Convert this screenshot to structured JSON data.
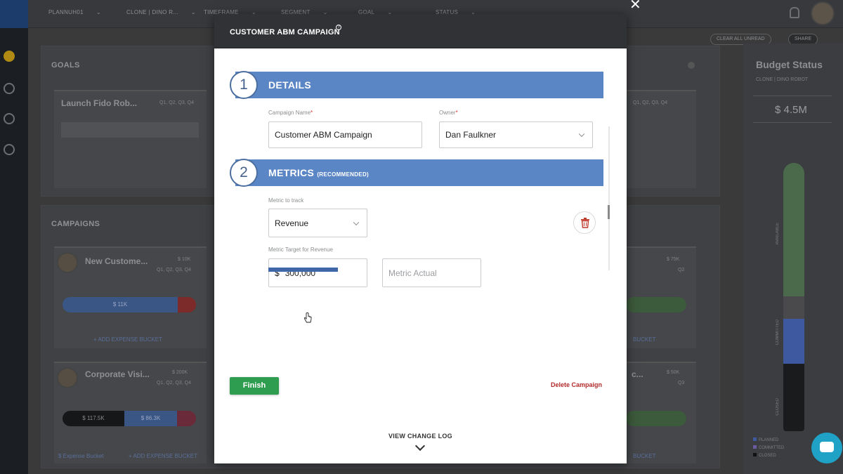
{
  "background": {
    "filters": [
      "PLANNUH01",
      "CLONE | DINO R...",
      "TIMEFRAME",
      "SEGMENT",
      "GOAL",
      "STATUS"
    ],
    "clear_all_label": "CLEAR ALL UNREAD",
    "share_label": "SHARE",
    "goals_title": "GOALS",
    "goal_card": {
      "name": "Launch Fido Rob...",
      "quarters": "Q1, Q2, Q3, Q4",
      "quarters_right": "Q1, Q2, Q3, Q4"
    },
    "campaigns_title": "CAMPAIGNS",
    "campaign_cards": [
      {
        "name": "New Custome...",
        "amount": "$ 10K",
        "quarters": "Q1, Q2, Q3, Q4",
        "bar_label": "$ 11K"
      },
      {
        "name": "Corporate Visi...",
        "amount": "$ 200K",
        "quarters": "Q1, Q2, Q3, Q4",
        "bar_left": "$ 117.5K",
        "bar_right": "$ 86.3K"
      }
    ],
    "right_cards": [
      {
        "amount": "$ 75K",
        "quarter": "Q2"
      },
      {
        "name_fragment": "c...",
        "amount": "$ 50K",
        "quarter": "Q3"
      }
    ],
    "add_expense_label": "+ ADD EXPENSE BUCKET",
    "expense_bucket_label": "$ Expense Bucket",
    "bucket_fragment": "BUCKET",
    "budget_status": {
      "title": "Budget Status",
      "subtitle": "CLONE | DINO ROBOT",
      "amount": "$ 4.5M",
      "labels": [
        "AVAILABLE",
        "COMMITTED",
        "CLOSED"
      ],
      "legend": [
        "PLANNED",
        "COMMITTED",
        "CLOSED"
      ]
    }
  },
  "modal": {
    "title": "CUSTOMER ABM CAMPAIGN",
    "details": {
      "step": "1",
      "title": "DETAILS",
      "campaign_name_label": "Campaign Name",
      "campaign_name_value": "Customer ABM Campaign",
      "owner_label": "Owner",
      "owner_value": "Dan Faulkner"
    },
    "metrics": {
      "step": "2",
      "title": "METRICS",
      "title_note": "(RECOMMENDED)",
      "metric_label": "Metric to track",
      "metric_value": "Revenue",
      "target_label": "Metric Target for Revenue",
      "currency_symbol": "$",
      "target_value": "300,000",
      "actual_placeholder": "Metric Actual"
    },
    "finish_label": "Finish",
    "delete_label": "Delete Campaign",
    "change_log_label": "VIEW CHANGE LOG"
  },
  "colors": {
    "section_blue": "#5b86c5",
    "finish_green": "#2e9d4f",
    "delete_red": "#b42a2a",
    "chat_teal": "#1fa2c6"
  }
}
